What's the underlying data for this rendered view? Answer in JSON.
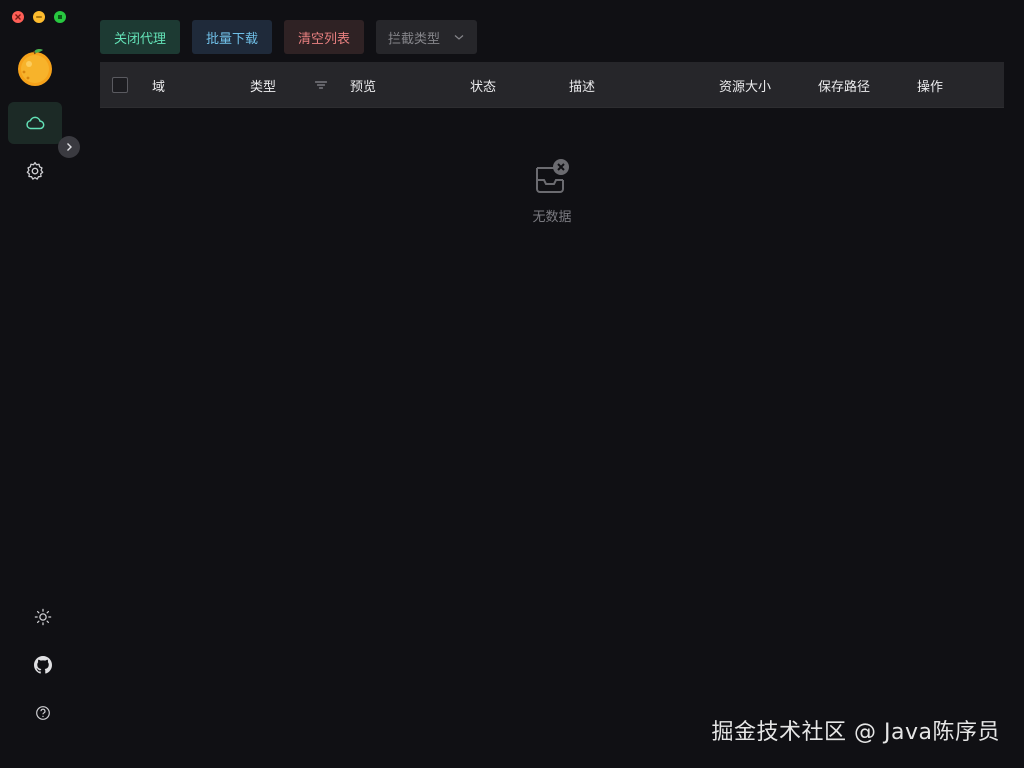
{
  "icons": {
    "window_close": "close-icon",
    "window_minimize": "minimize-icon",
    "window_maximize": "maximize-icon",
    "logo": "orange-logo-icon",
    "nav_cloud": "cloud-icon",
    "nav_settings": "gear-icon",
    "collapse": "chevron-right-icon",
    "theme": "sun-icon",
    "github": "github-icon",
    "help": "help-circle-icon",
    "filter": "filter-icon",
    "select_arrow": "chevron-down-icon",
    "empty": "empty-inbox-icon"
  },
  "colors": {
    "background": "#101014",
    "accent_green": "#63e2b7",
    "accent_blue": "#70c0e8",
    "accent_red": "#e88080",
    "header_bg": "#26262a"
  },
  "toolbar": {
    "proxy_label": "关闭代理",
    "download_label": "批量下载",
    "clear_label": "清空列表",
    "filter_select_value": "拦截类型"
  },
  "table": {
    "columns": [
      "域",
      "类型",
      "预览",
      "状态",
      "描述",
      "资源大小",
      "保存路径",
      "操作"
    ],
    "rows": [],
    "empty_text": "无数据"
  },
  "watermark": "掘金技术社区 @ Java陈序员"
}
